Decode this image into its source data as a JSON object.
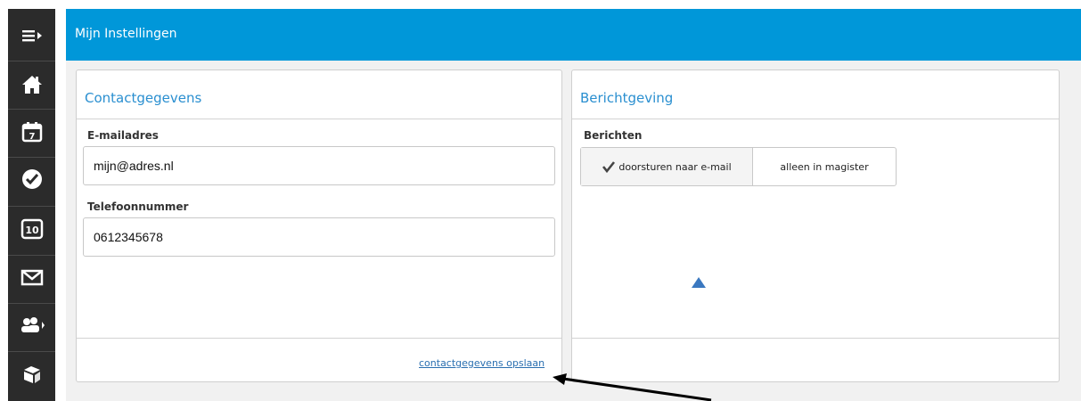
{
  "header": {
    "title": "Mijn Instellingen"
  },
  "sidebar": {
    "items": [
      {
        "icon": "menu-toggle-icon"
      },
      {
        "icon": "home-icon"
      },
      {
        "icon": "calendar-icon",
        "value": "7"
      },
      {
        "icon": "checkmark-icon"
      },
      {
        "icon": "grades-icon",
        "value": "10"
      },
      {
        "icon": "mail-icon"
      },
      {
        "icon": "users-icon"
      },
      {
        "icon": "books-icon"
      }
    ]
  },
  "contact": {
    "title": "Contactgegevens",
    "email_label": "E-mailadres",
    "email_value": "mijn@adres.nl",
    "phone_label": "Telefoonnummer",
    "phone_value": "0612345678",
    "save_link": "contactgegevens opslaan"
  },
  "notifications": {
    "title": "Berichtgeving",
    "messages_label": "Berichten",
    "options": [
      {
        "label": "doorsturen naar e-mail",
        "selected": true
      },
      {
        "label": "alleen in magister",
        "selected": false
      }
    ]
  },
  "colors": {
    "header": "#0097d9",
    "sidebar": "#2b2b2b",
    "link": "#2a6fb0",
    "accent": "#3a78c0"
  }
}
